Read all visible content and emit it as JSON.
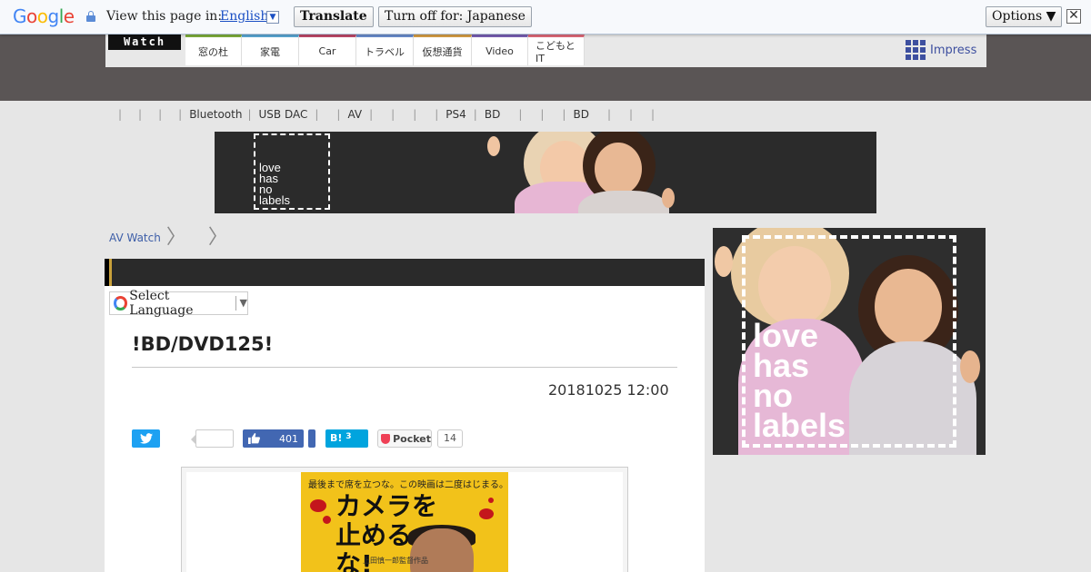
{
  "translate_bar": {
    "logo_letters": [
      "G",
      "o",
      "o",
      "g",
      "l",
      "e"
    ],
    "view_text": "View this page in:",
    "language": "English",
    "lang_arrow": "▼",
    "translate_btn": "Translate",
    "turn_off_btn": "Turn off for: Japanese",
    "options_btn": "Options ▼",
    "close_glyph": "✕"
  },
  "header": {
    "logo": "Watch",
    "tabs": [
      {
        "label": "窓の杜",
        "color": "#7fb03c"
      },
      {
        "label": "家電",
        "color": "#5aa9d6"
      },
      {
        "label": "Car",
        "color": "#c14a6b"
      },
      {
        "label": "トラベル",
        "color": "#6a8fd0"
      },
      {
        "label": "仮想通貨",
        "color": "#d8a046"
      },
      {
        "label": "Video",
        "color": "#7a5fb5"
      },
      {
        "label": "こどもとIT",
        "color": "#e26b7a"
      }
    ],
    "brand": "Impress"
  },
  "subnav": {
    "items": [
      "|",
      "|",
      "|",
      "|",
      "Bluetooth",
      "|",
      "USB DAC",
      "|",
      "|",
      "AV",
      "|",
      "|",
      "|",
      "|",
      "PS4",
      "|",
      "BD",
      "|",
      "|",
      "|",
      "BD",
      "|",
      "|",
      "|"
    ]
  },
  "banner": {
    "brand_lines": [
      "love",
      "has",
      "no",
      "labels"
    ]
  },
  "breadcrumb": {
    "home": "AV Watch",
    "sep": "〉"
  },
  "article": {
    "select_language": "Select Language",
    "select_arrow": "▼",
    "title": "!BD/DVD125!",
    "date": "20181025 12:00",
    "share": {
      "facebook_count": "401",
      "hatena_label": "B!",
      "hatena_count": "3",
      "pocket_label": "Pocket",
      "pocket_count": "14"
    },
    "poster": {
      "tagline": "最後まで席を立つな。この映画は二度はじまる。",
      "title_line1": "カメラを",
      "title_line2": "止めるな!",
      "credit": "上田慎一郎監督作品"
    }
  },
  "side_ad": {
    "brand_lines": [
      "love",
      "has",
      "no",
      "labels"
    ]
  },
  "colors": {
    "accent_blue": "#3d5ea8",
    "twitter": "#1da1f2",
    "facebook": "#4267b2",
    "hatena": "#00a4de",
    "pocket": "#ef4056"
  }
}
